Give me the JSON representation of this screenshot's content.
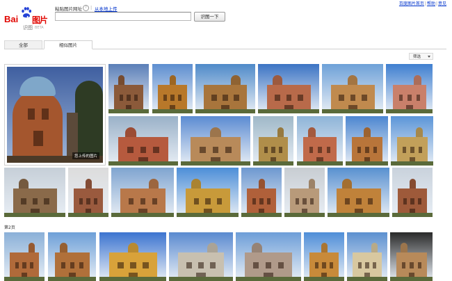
{
  "top_links": [
    "百度图片首页",
    "帮助",
    "意见"
  ],
  "logo": {
    "bai": "Bai",
    "du": "du",
    "tupian": "图片",
    "shitu": "识图",
    "beta": "BETA"
  },
  "paste_label": "粘贴图片网址",
  "help_glyph": "?",
  "separator": "|",
  "upload_link": "从本地上传",
  "url_input_value": "",
  "search_button": "识图一下",
  "tabs": [
    "全部",
    "相似图片"
  ],
  "filter_label": "筛选",
  "main_caption": "您上传的图片",
  "page_label": "第2页",
  "colors": {
    "brand_red": "#e10601",
    "brand_blue": "#2442d6",
    "link_blue": "#0033cc"
  }
}
